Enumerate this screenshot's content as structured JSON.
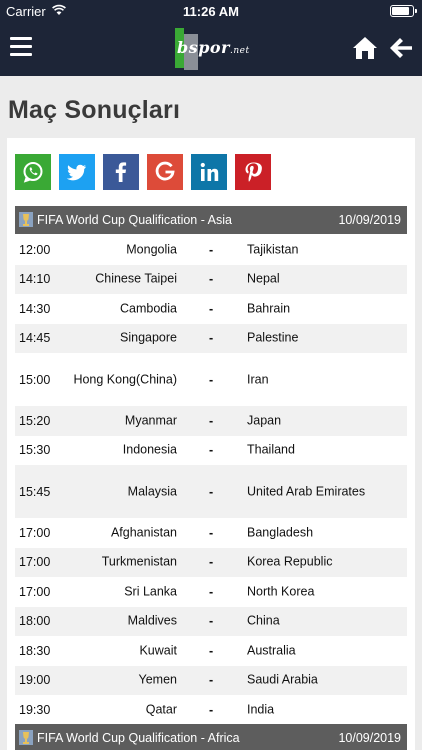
{
  "status_bar": {
    "carrier": "Carrier",
    "time": "11:26 AM",
    "battery_level": 0.9
  },
  "header": {
    "logo_text": "bspor",
    "logo_suffix": ".net",
    "menu_icon": "hamburger-menu-icon",
    "home_icon": "home-icon",
    "back_icon": "arrow-left-icon"
  },
  "page": {
    "title": "Maç Sonuçları"
  },
  "share": [
    {
      "name": "whatsapp",
      "icon": "whatsapp-icon",
      "color": "#3aa935"
    },
    {
      "name": "twitter",
      "icon": "twitter-icon",
      "color": "#1da1f2"
    },
    {
      "name": "facebook",
      "icon": "facebook-icon",
      "color": "#3b5998"
    },
    {
      "name": "google",
      "icon": "google-icon",
      "color": "#dd4b39"
    },
    {
      "name": "linkedin",
      "icon": "linkedin-icon",
      "color": "#0e76a8"
    },
    {
      "name": "pinterest",
      "icon": "pinterest-icon",
      "color": "#cb2027"
    }
  ],
  "leagues": [
    {
      "name": "FIFA World Cup Qualification - Asia",
      "date": "10/09/2019",
      "matches": [
        {
          "time": "12:00",
          "home": "Mongolia",
          "sep": "-",
          "away": "Tajikistan"
        },
        {
          "time": "14:10",
          "home": "Chinese Taipei",
          "sep": "-",
          "away": "Nepal"
        },
        {
          "time": "14:30",
          "home": "Cambodia",
          "sep": "-",
          "away": "Bahrain"
        },
        {
          "time": "14:45",
          "home": "Singapore",
          "sep": "-",
          "away": "Palestine"
        },
        {
          "time": "15:00",
          "home": "Hong Kong(China)",
          "sep": "-",
          "away": "Iran"
        },
        {
          "time": "15:20",
          "home": "Myanmar",
          "sep": "-",
          "away": "Japan"
        },
        {
          "time": "15:30",
          "home": "Indonesia",
          "sep": "-",
          "away": "Thailand"
        },
        {
          "time": "15:45",
          "home": "Malaysia",
          "sep": "-",
          "away": "United Arab Emirates"
        },
        {
          "time": "17:00",
          "home": "Afghanistan",
          "sep": "-",
          "away": "Bangladesh"
        },
        {
          "time": "17:00",
          "home": "Turkmenistan",
          "sep": "-",
          "away": "Korea Republic"
        },
        {
          "time": "17:00",
          "home": "Sri Lanka",
          "sep": "-",
          "away": "North Korea"
        },
        {
          "time": "18:00",
          "home": "Maldives",
          "sep": "-",
          "away": "China"
        },
        {
          "time": "18:30",
          "home": "Kuwait",
          "sep": "-",
          "away": "Australia"
        },
        {
          "time": "19:00",
          "home": "Yemen",
          "sep": "-",
          "away": "Saudi Arabia"
        },
        {
          "time": "19:30",
          "home": "Qatar",
          "sep": "-",
          "away": "India"
        }
      ]
    },
    {
      "name": "FIFA World Cup Qualification - Africa",
      "date": "10/09/2019",
      "matches": []
    }
  ]
}
